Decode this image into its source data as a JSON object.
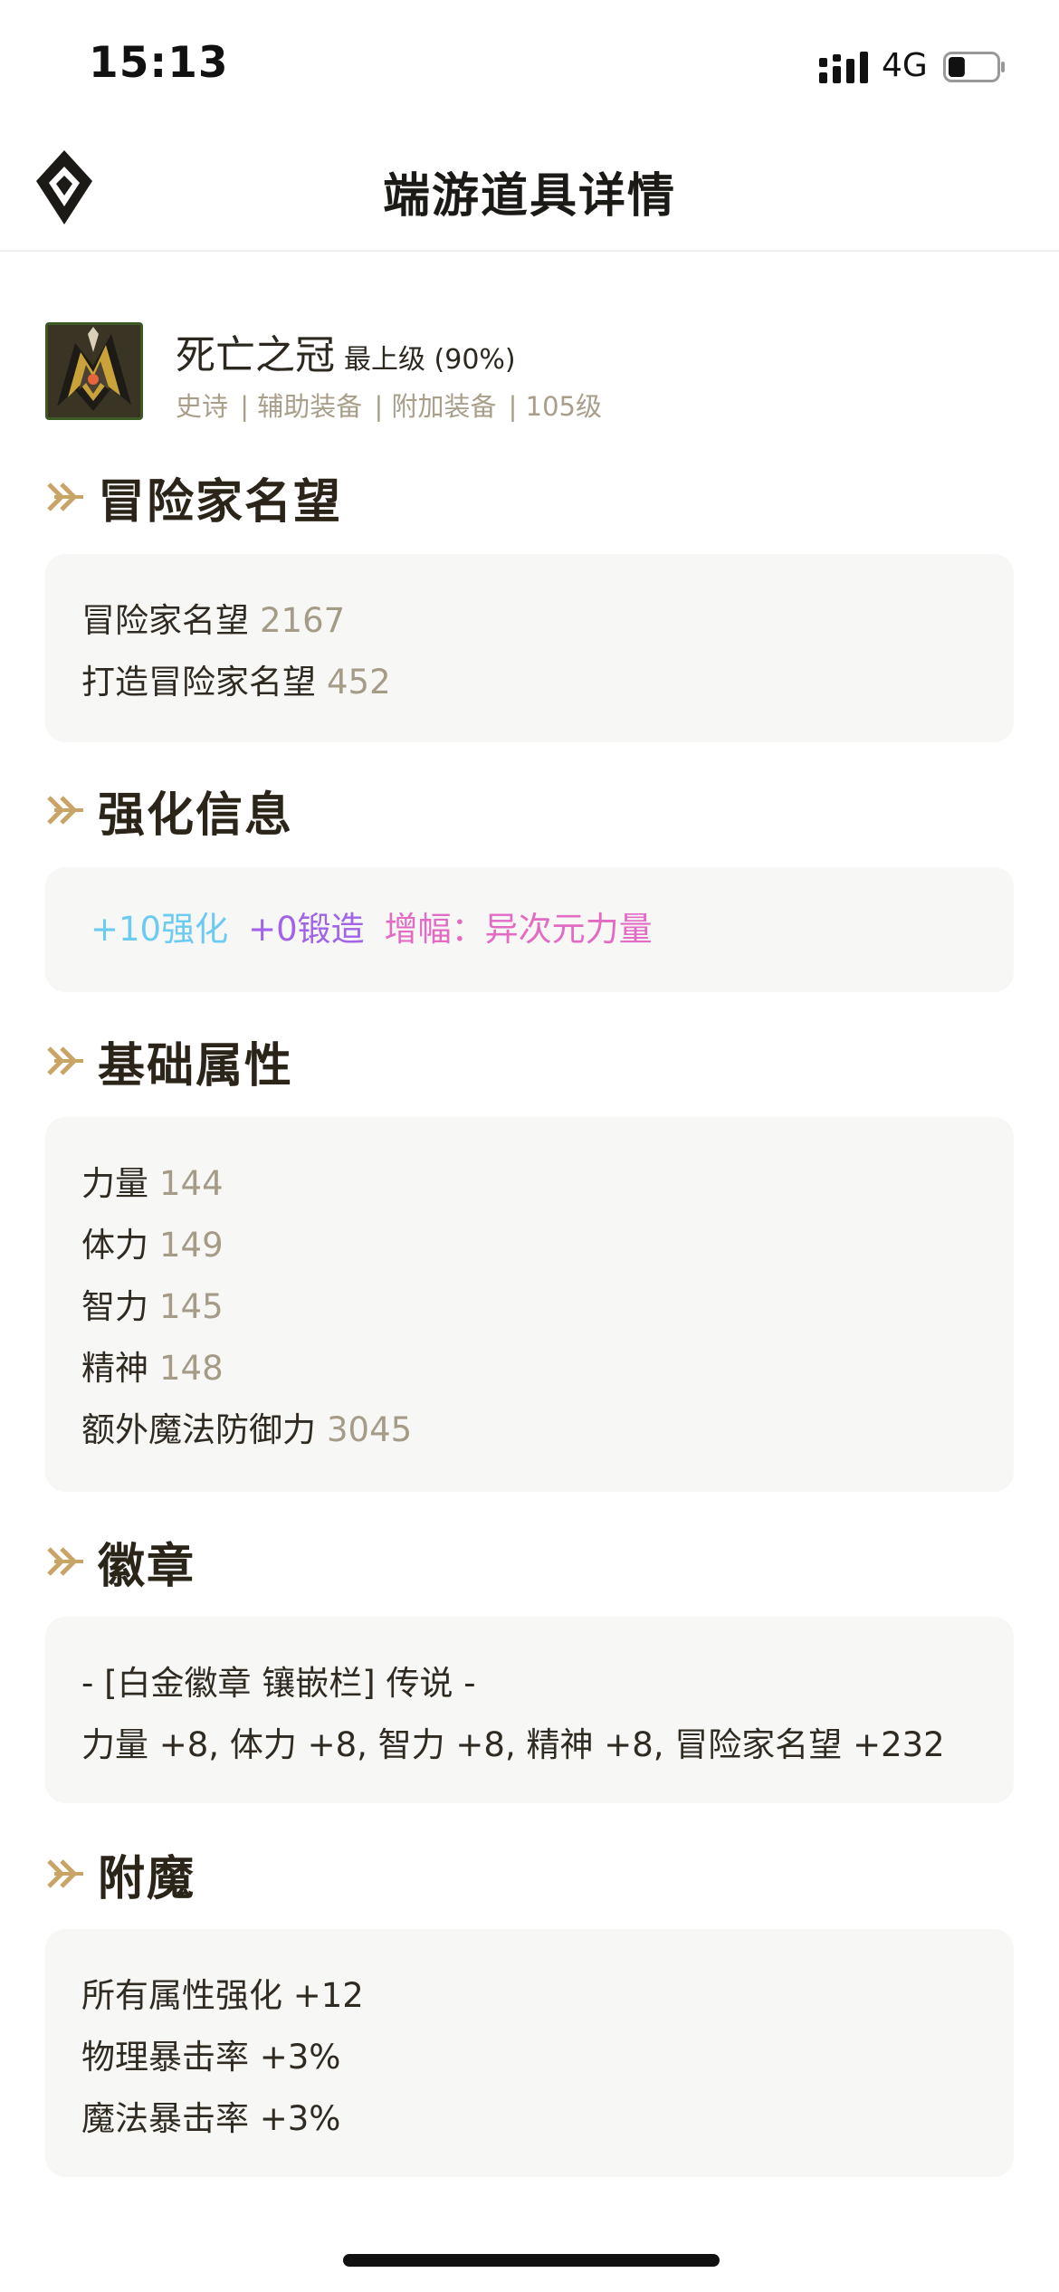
{
  "status_bar": {
    "time": "15:13",
    "network": "4G",
    "battery_level": 0.35
  },
  "nav": {
    "title": "端游道具详情",
    "logo_icon": "diamond-logo-icon"
  },
  "item": {
    "name": "死亡之冠",
    "grade": "最上级 (90%)",
    "tags": [
      "史诗",
      "| 辅助装备",
      "| 附加装备",
      "| 105级"
    ],
    "icon": "helmet-item-icon"
  },
  "sections": {
    "reputation": {
      "title": "冒险家名望",
      "rows": [
        {
          "label": "冒险家名望",
          "value": "2167"
        },
        {
          "label": "打造冒险家名望",
          "value": "452"
        }
      ]
    },
    "enhance": {
      "title": "强化信息",
      "reinforce": "+10强化",
      "forge": "+0锻造",
      "amplify": "增幅：异次元力量",
      "colors": {
        "reinforce": "#6ccbf0",
        "forge": "#a264e6",
        "amplify": "#e26bc4"
      }
    },
    "base": {
      "title": "基础属性",
      "rows": [
        {
          "label": "力量",
          "value": "144"
        },
        {
          "label": "体力",
          "value": "149"
        },
        {
          "label": "智力",
          "value": "145"
        },
        {
          "label": "精神",
          "value": "148"
        },
        {
          "label": "额外魔法防御力",
          "value": "3045"
        }
      ]
    },
    "emblem": {
      "title": "徽章",
      "lines": [
        "- [白金徽章 镶嵌栏] 传说 -",
        "力量 +8, 体力 +8, 智力 +8, 精神 +8, 冒险家名望 +232"
      ]
    },
    "enchant": {
      "title": "附魔",
      "lines": [
        "所有属性强化 +12",
        "物理暴击率 +3%",
        "魔法暴击率 +3%"
      ]
    }
  },
  "accent_color": "#c9a467"
}
